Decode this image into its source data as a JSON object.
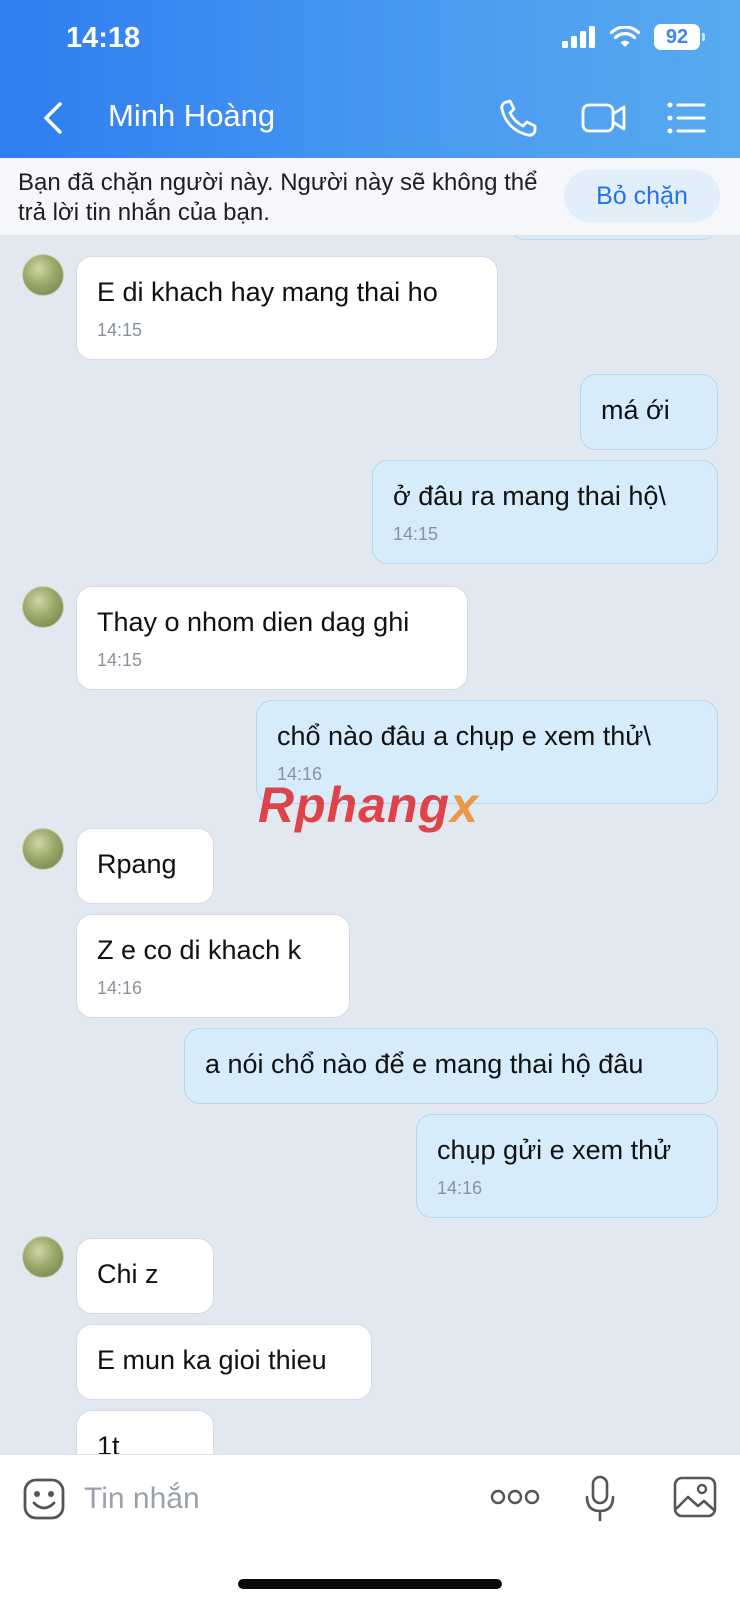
{
  "status_bar": {
    "time": "14:18",
    "battery": "92"
  },
  "header": {
    "contact_name": "Minh Hoàng"
  },
  "blocked_notice": {
    "text": "Bạn đã chặn người này. Người này sẽ không thể trả lời tin nhắn của bạn.",
    "unblock_label": "Bỏ chặn"
  },
  "messages": [
    {
      "dir": "in",
      "text": "E di khach hay mang thai ho",
      "time": "14:15"
    },
    {
      "dir": "out",
      "text": "má ới",
      "time": ""
    },
    {
      "dir": "out",
      "text": "ở đâu ra mang thai hộ\\",
      "time": "14:15"
    },
    {
      "dir": "in",
      "text": "Thay o nhom dien dag ghi",
      "time": "14:15"
    },
    {
      "dir": "out",
      "text": "chổ nào đâu a chụp e xem thử\\",
      "time": "14:16"
    },
    {
      "dir": "in",
      "text": "Rpang",
      "time": ""
    },
    {
      "dir": "in",
      "text": "Z e co di khach k",
      "time": "14:16"
    },
    {
      "dir": "out",
      "text": "a nói chổ nào để e mang thai hộ đâu",
      "time": ""
    },
    {
      "dir": "out",
      "text": "chụp gửi e xem thử",
      "time": "14:16"
    },
    {
      "dir": "in",
      "text": "Chi z",
      "time": ""
    },
    {
      "dir": "in",
      "text": "E mun ka gioi thieu",
      "time": ""
    },
    {
      "dir": "in",
      "text": "1t",
      "time": ""
    }
  ],
  "watermark": {
    "main": "Rphang",
    "accent": "x"
  },
  "composer": {
    "placeholder": "Tin nhắn"
  }
}
